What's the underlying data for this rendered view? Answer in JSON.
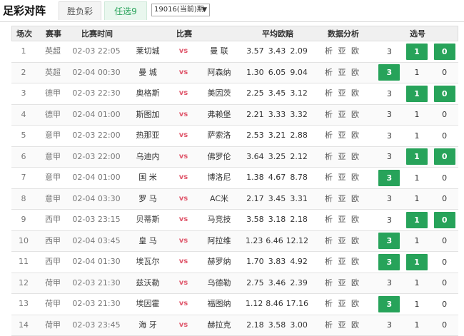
{
  "header": {
    "title": "足彩对阵",
    "tabs": [
      "胜负彩",
      "任选9"
    ],
    "period": "19016(当前)期",
    "period_arrow": "▼"
  },
  "columns": [
    "场次",
    "赛事",
    "比赛时间",
    "比赛",
    "平均欧赔",
    "数据分析",
    "选号"
  ],
  "vs_label": "vs",
  "analysis_label": "析 亚 欧",
  "colors": {
    "selected": "#27a35a",
    "vs": "#e05a6e"
  },
  "rows": [
    {
      "no": "1",
      "league": "英超",
      "time": "02-03 22:05",
      "home": "莱切城",
      "away": "曼 联",
      "odds": [
        "3.57",
        "3.43",
        "2.09"
      ],
      "picks": [
        {
          "v": "3",
          "on": false
        },
        {
          "v": "1",
          "on": true
        },
        {
          "v": "0",
          "on": true
        }
      ]
    },
    {
      "no": "2",
      "league": "英超",
      "time": "02-04 00:30",
      "home": "曼 城",
      "away": "阿森纳",
      "odds": [
        "1.30",
        "6.05",
        "9.04"
      ],
      "picks": [
        {
          "v": "3",
          "on": true
        },
        {
          "v": "1",
          "on": false
        },
        {
          "v": "0",
          "on": false
        }
      ]
    },
    {
      "no": "3",
      "league": "德甲",
      "time": "02-03 22:30",
      "home": "奥格斯",
      "away": "美因茨",
      "odds": [
        "2.25",
        "3.45",
        "3.12"
      ],
      "picks": [
        {
          "v": "3",
          "on": false
        },
        {
          "v": "1",
          "on": true
        },
        {
          "v": "0",
          "on": true
        }
      ]
    },
    {
      "no": "4",
      "league": "德甲",
      "time": "02-04 01:00",
      "home": "斯图加",
      "away": "弗赖堡",
      "odds": [
        "2.21",
        "3.33",
        "3.32"
      ],
      "picks": [
        {
          "v": "3",
          "on": false
        },
        {
          "v": "1",
          "on": false
        },
        {
          "v": "0",
          "on": false
        }
      ]
    },
    {
      "no": "5",
      "league": "意甲",
      "time": "02-03 22:00",
      "home": "热那亚",
      "away": "萨索洛",
      "odds": [
        "2.53",
        "3.21",
        "2.88"
      ],
      "picks": [
        {
          "v": "3",
          "on": false
        },
        {
          "v": "1",
          "on": false
        },
        {
          "v": "0",
          "on": false
        }
      ]
    },
    {
      "no": "6",
      "league": "意甲",
      "time": "02-03 22:00",
      "home": "乌迪内",
      "away": "佛罗伦",
      "odds": [
        "3.64",
        "3.25",
        "2.12"
      ],
      "picks": [
        {
          "v": "3",
          "on": false
        },
        {
          "v": "1",
          "on": true
        },
        {
          "v": "0",
          "on": true
        }
      ]
    },
    {
      "no": "7",
      "league": "意甲",
      "time": "02-04 01:00",
      "home": "国 米",
      "away": "博洛尼",
      "odds": [
        "1.38",
        "4.67",
        "8.78"
      ],
      "picks": [
        {
          "v": "3",
          "on": true
        },
        {
          "v": "1",
          "on": false
        },
        {
          "v": "0",
          "on": false
        }
      ]
    },
    {
      "no": "8",
      "league": "意甲",
      "time": "02-04 03:30",
      "home": "罗 马",
      "away": "AC米",
      "odds": [
        "2.17",
        "3.45",
        "3.31"
      ],
      "picks": [
        {
          "v": "3",
          "on": false
        },
        {
          "v": "1",
          "on": false
        },
        {
          "v": "0",
          "on": false
        }
      ]
    },
    {
      "no": "9",
      "league": "西甲",
      "time": "02-03 23:15",
      "home": "贝蒂斯",
      "away": "马竞技",
      "odds": [
        "3.58",
        "3.18",
        "2.18"
      ],
      "picks": [
        {
          "v": "3",
          "on": false
        },
        {
          "v": "1",
          "on": true
        },
        {
          "v": "0",
          "on": true
        }
      ]
    },
    {
      "no": "10",
      "league": "西甲",
      "time": "02-04 03:45",
      "home": "皇 马",
      "away": "阿拉维",
      "odds": [
        "1.23",
        "6.46",
        "12.12"
      ],
      "picks": [
        {
          "v": "3",
          "on": true
        },
        {
          "v": "1",
          "on": false
        },
        {
          "v": "0",
          "on": false
        }
      ]
    },
    {
      "no": "11",
      "league": "西甲",
      "time": "02-04 01:30",
      "home": "埃瓦尔",
      "away": "赫罗纳",
      "odds": [
        "1.70",
        "3.83",
        "4.92"
      ],
      "picks": [
        {
          "v": "3",
          "on": true
        },
        {
          "v": "1",
          "on": true
        },
        {
          "v": "0",
          "on": false
        }
      ]
    },
    {
      "no": "12",
      "league": "荷甲",
      "time": "02-03 21:30",
      "home": "兹沃勒",
      "away": "乌德勒",
      "odds": [
        "2.75",
        "3.46",
        "2.39"
      ],
      "picks": [
        {
          "v": "3",
          "on": false
        },
        {
          "v": "1",
          "on": false
        },
        {
          "v": "0",
          "on": false
        }
      ]
    },
    {
      "no": "13",
      "league": "荷甲",
      "time": "02-03 21:30",
      "home": "埃因霍",
      "away": "福图纳",
      "odds": [
        "1.12",
        "8.46",
        "17.16"
      ],
      "picks": [
        {
          "v": "3",
          "on": true
        },
        {
          "v": "1",
          "on": false
        },
        {
          "v": "0",
          "on": false
        }
      ]
    },
    {
      "no": "14",
      "league": "荷甲",
      "time": "02-03 23:45",
      "home": "海 牙",
      "away": "赫拉克",
      "odds": [
        "2.18",
        "3.58",
        "3.00"
      ],
      "picks": [
        {
          "v": "3",
          "on": false
        },
        {
          "v": "1",
          "on": false
        },
        {
          "v": "0",
          "on": false
        }
      ]
    }
  ]
}
